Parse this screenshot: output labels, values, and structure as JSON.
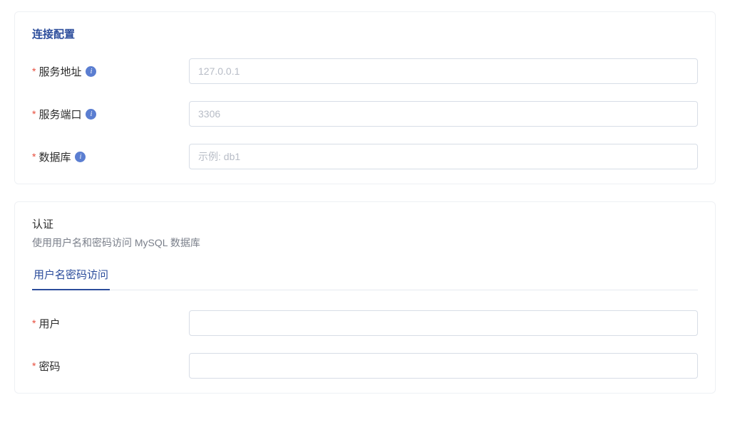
{
  "connection": {
    "title": "连接配置",
    "fields": {
      "host": {
        "label": "服务地址",
        "placeholder": "127.0.0.1",
        "value": ""
      },
      "port": {
        "label": "服务端口",
        "placeholder": "3306",
        "value": ""
      },
      "database": {
        "label": "数据库",
        "placeholder": "示例: db1",
        "value": ""
      }
    }
  },
  "auth": {
    "heading": "认证",
    "description": "使用用户名和密码访问 MySQL 数据库",
    "tab_label": "用户名密码访问",
    "fields": {
      "user": {
        "label": "用户",
        "placeholder": "",
        "value": ""
      },
      "password": {
        "label": "密码",
        "placeholder": "",
        "value": ""
      }
    }
  },
  "icons": {
    "info_glyph": "i"
  }
}
